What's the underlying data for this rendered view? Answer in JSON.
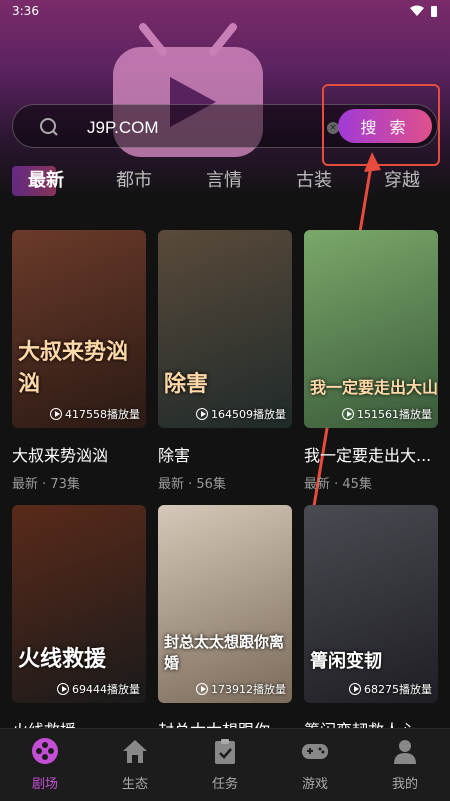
{
  "status_bar": {
    "time": "3:36"
  },
  "search": {
    "value": "J9P.COM",
    "button_label": "搜 索"
  },
  "tabs": [
    "最新",
    "都市",
    "言情",
    "古装",
    "穿越"
  ],
  "cards": [
    {
      "poster_text": "大叔来势汹汹",
      "play_count": "417558播放量",
      "title": "大叔来势汹汹",
      "meta": "最新 · 73集",
      "colors": [
        "#6b3a2a",
        "#2a1a14"
      ]
    },
    {
      "poster_text": "除害",
      "play_count": "164509播放量",
      "title": "除害",
      "meta": "最新 · 56集",
      "colors": [
        "#5a4a3a",
        "#1f2a2a"
      ]
    },
    {
      "poster_text": "我一定要走出大山",
      "play_count": "151561播放量",
      "title": "我一定要走出大...",
      "meta": "最新 · 45集",
      "colors": [
        "#7aa86a",
        "#3a5a3a"
      ]
    },
    {
      "poster_text": "火线救援",
      "play_count": "69444播放量",
      "title": "火线救援",
      "meta": "",
      "colors": [
        "#5a2a1a",
        "#1a1a1a"
      ]
    },
    {
      "poster_text": "封总太太想跟你离婚",
      "play_count": "173912播放量",
      "title": "封总太太想跟你",
      "meta": "",
      "colors": [
        "#d6c8b8",
        "#7a6a5a"
      ]
    },
    {
      "poster_text": "箐闲变韧",
      "play_count": "68275播放量",
      "title": "箐闲变韧救人心",
      "meta": "",
      "colors": [
        "#4a4a52",
        "#1e1e24"
      ]
    }
  ],
  "bottom_nav": [
    {
      "label": "剧场",
      "icon": "film-reel-icon",
      "active": true
    },
    {
      "label": "生态",
      "icon": "home-icon",
      "active": false
    },
    {
      "label": "任务",
      "icon": "clipboard-icon",
      "active": false
    },
    {
      "label": "游戏",
      "icon": "gamepad-icon",
      "active": false
    },
    {
      "label": "我的",
      "icon": "user-icon",
      "active": false
    }
  ],
  "colors": {
    "accent": "#c44fd6",
    "highlight": "#e74c3c",
    "background": "#121212"
  }
}
